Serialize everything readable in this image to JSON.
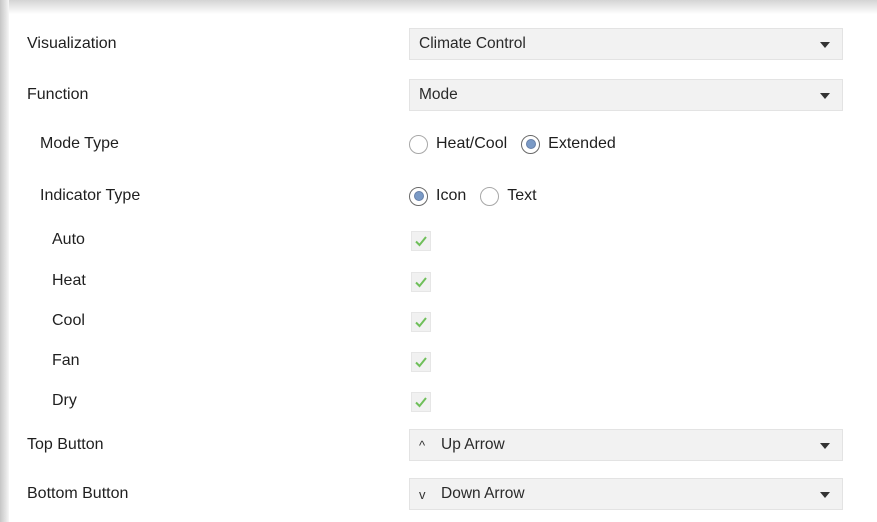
{
  "rows": {
    "visualization": {
      "label": "Visualization",
      "value": "Climate Control"
    },
    "function": {
      "label": "Function",
      "value": "Mode"
    },
    "mode_type": {
      "label": "Mode Type",
      "options": [
        {
          "label": "Heat/Cool",
          "selected": false
        },
        {
          "label": "Extended",
          "selected": true
        }
      ]
    },
    "indicator_type": {
      "label": "Indicator Type",
      "options": [
        {
          "label": "Icon",
          "selected": true
        },
        {
          "label": "Text",
          "selected": false
        }
      ]
    },
    "modes": [
      {
        "label": "Auto",
        "checked": true
      },
      {
        "label": "Heat",
        "checked": true
      },
      {
        "label": "Cool",
        "checked": true
      },
      {
        "label": "Fan",
        "checked": true
      },
      {
        "label": "Dry",
        "checked": true
      }
    ],
    "top_button": {
      "label": "Top Button",
      "prefix_icon": "up-arrow-icon",
      "prefix_glyph": "^",
      "value": "Up Arrow"
    },
    "bottom_button": {
      "label": "Bottom Button",
      "prefix_icon": "down-arrow-icon",
      "prefix_glyph": "v",
      "value": "Down Arrow"
    }
  },
  "colors": {
    "check": "#6fbf5a",
    "radio_dot": "#7a9ac6",
    "select_bg": "#f2f2f2"
  }
}
